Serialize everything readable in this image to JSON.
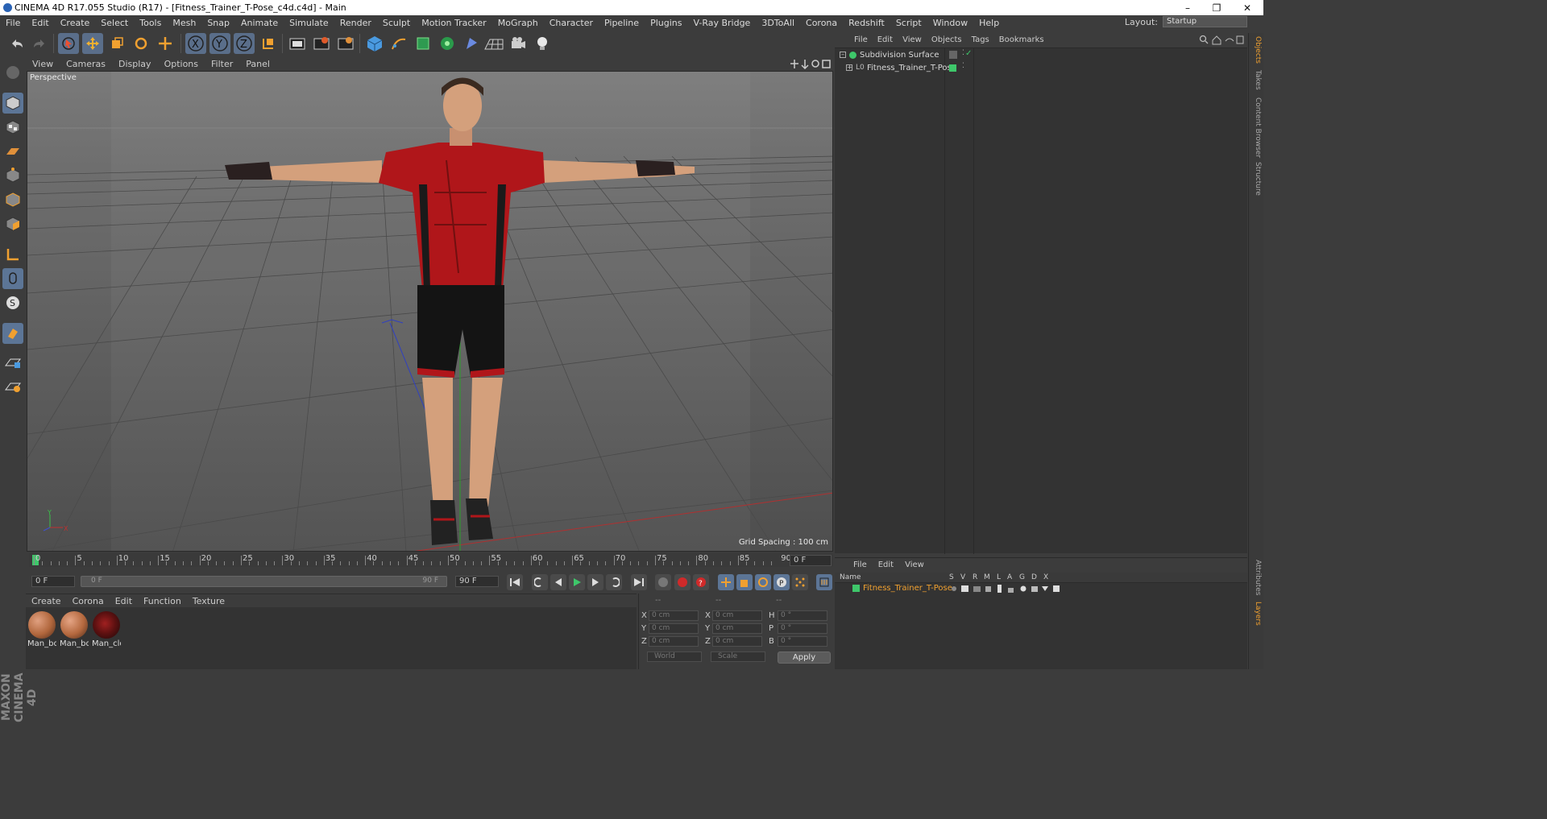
{
  "window": {
    "title": "CINEMA 4D R17.055 Studio (R17) - [Fitness_Trainer_T-Pose_c4d.c4d] - Main",
    "minimize": "–",
    "restore": "❐",
    "close": "✕"
  },
  "menu": [
    "File",
    "Edit",
    "Create",
    "Select",
    "Tools",
    "Mesh",
    "Snap",
    "Animate",
    "Simulate",
    "Render",
    "Sculpt",
    "Motion Tracker",
    "MoGraph",
    "Character",
    "Pipeline",
    "Plugins",
    "V-Ray Bridge",
    "3DToAll",
    "Corona",
    "Redshift",
    "Script",
    "Window",
    "Help"
  ],
  "layout": {
    "label": "Layout:",
    "value": "Startup"
  },
  "viewport": {
    "menu": [
      "View",
      "Cameras",
      "Display",
      "Options",
      "Filter",
      "Panel"
    ],
    "label": "Perspective",
    "grid_spacing": "Grid Spacing : 100 cm"
  },
  "timeline": {
    "ticks": [
      "0",
      "5",
      "10",
      "15",
      "20",
      "25",
      "30",
      "35",
      "40",
      "45",
      "50",
      "55",
      "60",
      "65",
      "70",
      "75",
      "80",
      "85",
      "90"
    ],
    "current_frame": "0 F",
    "start": "0 F",
    "range_start": "0 F",
    "range_end": "90 F",
    "end": "90 F"
  },
  "material_manager": {
    "menu": [
      "Create",
      "Corona",
      "Edit",
      "Function",
      "Texture"
    ],
    "materials": [
      {
        "name": "Man_bo",
        "color": "#b0663c"
      },
      {
        "name": "Man_bo",
        "color": "#b4683e"
      },
      {
        "name": "Man_clo",
        "color": "#5a1010"
      }
    ]
  },
  "coordinates": {
    "header": [
      "--",
      "--",
      "--"
    ],
    "rows": [
      {
        "a": "X",
        "pos": "0 cm",
        "b": "X",
        "size": "0 cm",
        "c": "H",
        "rot": "0 °"
      },
      {
        "a": "Y",
        "pos": "0 cm",
        "b": "Y",
        "size": "0 cm",
        "c": "P",
        "rot": "0 °"
      },
      {
        "a": "Z",
        "pos": "0 cm",
        "b": "Z",
        "size": "0 cm",
        "c": "B",
        "rot": "0 °"
      }
    ],
    "space": "World",
    "mode": "Scale",
    "apply": "Apply"
  },
  "object_manager": {
    "menu": [
      "File",
      "Edit",
      "View",
      "Objects",
      "Tags",
      "Bookmarks"
    ],
    "objects": [
      {
        "name": "Subdivision Surface"
      },
      {
        "name": "Fitness_Trainer_T-Pose"
      }
    ]
  },
  "layer_manager": {
    "menu": [
      "File",
      "Edit",
      "View"
    ],
    "columns": [
      "Name",
      "S",
      "V",
      "R",
      "M",
      "L",
      "A",
      "G",
      "D",
      "X"
    ],
    "layer": "Fitness_Trainer_T-Pose"
  },
  "right_tabs": [
    "Objects",
    "Takes",
    "Content Browser",
    "Structure"
  ],
  "right_tabs_lower": [
    "Attributes",
    "Layers"
  ],
  "brand": "MAXON CINEMA 4D",
  "colors": {
    "accent_blue": "#5c7596",
    "layer_orange": "#f0a030",
    "green": "#3ec76a"
  }
}
